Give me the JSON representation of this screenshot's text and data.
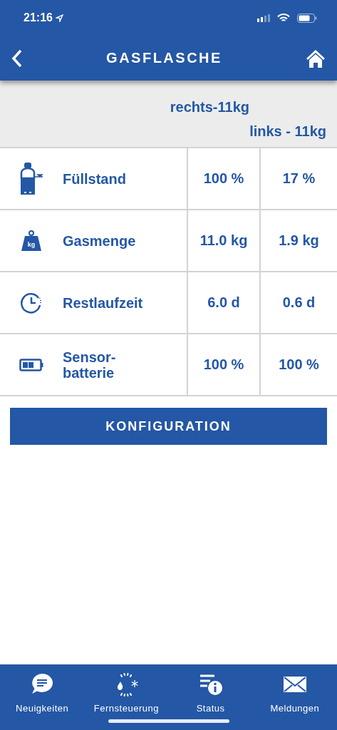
{
  "status_bar": {
    "time": "21:16"
  },
  "header": {
    "title": "GASFLASCHE"
  },
  "info": {
    "lines": [
      "rechts-11kg",
      "links - 11kg"
    ]
  },
  "rows": [
    {
      "kind": "cylinder",
      "label": "Füllstand",
      "values": [
        "100 %",
        "17 %"
      ]
    },
    {
      "kind": "weight",
      "icon_text": "kg",
      "label": "Gasmenge",
      "values": [
        "11.0 kg",
        "1.9 kg"
      ]
    },
    {
      "kind": "clock",
      "label": "Restlaufzeit",
      "values": [
        "6.0 d",
        "0.6 d"
      ]
    },
    {
      "kind": "battery",
      "label": "Sensor-\nbatterie",
      "values": [
        "100 %",
        "100 %"
      ]
    }
  ],
  "config_button": {
    "label": "KONFIGURATION"
  },
  "tab_bar": {
    "items": [
      {
        "kind": "chat",
        "label": "Neuigkeiten"
      },
      {
        "kind": "remote",
        "label": "Fernsteuerung"
      },
      {
        "kind": "status",
        "label": "Status"
      },
      {
        "kind": "mail",
        "label": "Meldungen"
      }
    ]
  }
}
